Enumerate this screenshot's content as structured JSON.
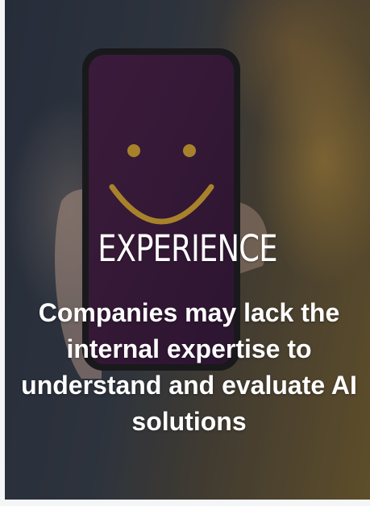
{
  "card": {
    "heading": "EXPERIENCE",
    "body": "Companies may lack the internal expertise to understand and evaluate AI solutions"
  },
  "scene": {
    "description_icon": "smiley-phone-photo",
    "colors": {
      "screen": "#3c1a3a",
      "smile": "#c99a2e",
      "phone_frame": "#1a1a1c"
    }
  }
}
